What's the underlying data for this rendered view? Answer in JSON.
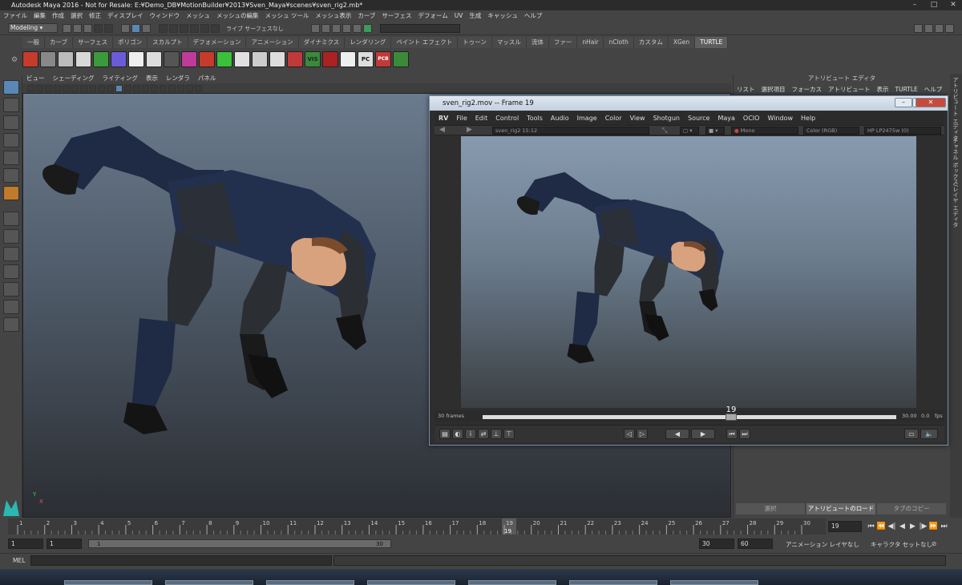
{
  "window": {
    "title": "Autodesk Maya 2016 - Not for Resale: E:¥Demo_DB¥MotionBuilder¥2013¥Sven_Maya¥scenes¥sven_rig2.mb*"
  },
  "menubar": [
    "ファイル",
    "編集",
    "作成",
    "選択",
    "修正",
    "ディスプレイ",
    "ウィンドウ",
    "メッシュ",
    "メッシュの編集",
    "メッシュ ツール",
    "メッシュ表示",
    "カーブ",
    "サーフェス",
    "デフォーム",
    "UV",
    "生成",
    "キャッシュ",
    "ヘルプ"
  ],
  "status": {
    "mode": "Modeling",
    "live_label": "ライブ サーフェスなし"
  },
  "shelf_tabs": [
    {
      "label": "一般",
      "active": false
    },
    {
      "label": "カーブ",
      "active": false
    },
    {
      "label": "サーフェス",
      "active": false
    },
    {
      "label": "ポリゴン",
      "active": false
    },
    {
      "label": "スカルプト",
      "active": false
    },
    {
      "label": "デフォメーション",
      "active": false
    },
    {
      "label": "アニメーション",
      "active": false
    },
    {
      "label": "ダイナミクス",
      "active": false
    },
    {
      "label": "レンダリング",
      "active": false
    },
    {
      "label": "ペイント エフェクト",
      "active": false
    },
    {
      "label": "トゥーン",
      "active": false
    },
    {
      "label": "マッスル",
      "active": false
    },
    {
      "label": "流体",
      "active": false
    },
    {
      "label": "ファー",
      "active": false
    },
    {
      "label": "nHair",
      "active": false
    },
    {
      "label": "nCloth",
      "active": false
    },
    {
      "label": "カスタム",
      "active": false
    },
    {
      "label": "XGen",
      "active": false
    },
    {
      "label": "TURTLE",
      "active": true
    }
  ],
  "shelf_icon_colors": [
    "#c63b2b",
    "#888",
    "#bbb",
    "#d8d8d8",
    "#3b9b3b",
    "#6b5bd8",
    "#eee",
    "#ddd",
    "#555",
    "#c03a9a",
    "#c63b2b",
    "#3bc03b",
    "#e0e0e0",
    "#ccc",
    "#ddd",
    "#c03a3a",
    "#3a8a3a",
    "#aa2222",
    "#eee",
    "#ddd",
    "#c03a3a",
    "#3a8a3a"
  ],
  "shelf_text_icons": {
    "vis": "VIS",
    "pc": "PC",
    "pcb": "PCB"
  },
  "viewport_menu": [
    "ビュー",
    "シェーディング",
    "ライティング",
    "表示",
    "レンダラ",
    "パネル"
  ],
  "viewport_axis": {
    "y": "Y",
    "x": "X"
  },
  "attr_editor": {
    "title": "アトリビュート エディタ",
    "menu": [
      "リスト",
      "選択項目",
      "フォーカス",
      "アトリビュート",
      "表示",
      "TURTLE",
      "ヘルプ"
    ],
    "buttons": [
      "選択",
      "アトリビュートのロード",
      "タブのコピー"
    ],
    "side_tabs": [
      "アトリビュート エディタ",
      "チャネル ボックス/レイヤ エディタ"
    ]
  },
  "rv": {
    "title": "sven_rig2.mov -- Frame 19",
    "menu": [
      "RV",
      "File",
      "Edit",
      "Control",
      "Tools",
      "Audio",
      "Image",
      "Color",
      "View",
      "Shotgun",
      "Source",
      "Maya",
      "OCIO",
      "Window",
      "Help"
    ],
    "source_label": "sven_rig2 15:12",
    "channel": "Mono",
    "color_mode": "Color (RGB)",
    "display": "HP LP2475w (0)",
    "frames_label": "30 frames",
    "current_frame": "19",
    "fps_value": "30.00",
    "speed": "0.0",
    "fps_unit": "fps",
    "timeline_position": 0.6
  },
  "timeline": {
    "ticks": [
      "1",
      "2",
      "3",
      "4",
      "5",
      "6",
      "7",
      "8",
      "9",
      "10",
      "11",
      "12",
      "13",
      "14",
      "15",
      "16",
      "17",
      "18",
      "19",
      "20",
      "21",
      "22",
      "23",
      "24",
      "25",
      "26",
      "27",
      "28",
      "29",
      "30"
    ],
    "current": "19",
    "current_field": "19"
  },
  "range": {
    "start": "1",
    "inner_start": "1",
    "slider_start": "1",
    "slider_end": "30",
    "end": "30",
    "outer_end": "60",
    "anim_layer": "アニメーション レイヤなし",
    "character_set": "キャラクタ セットなし"
  },
  "cmdline": {
    "label": "MEL"
  }
}
